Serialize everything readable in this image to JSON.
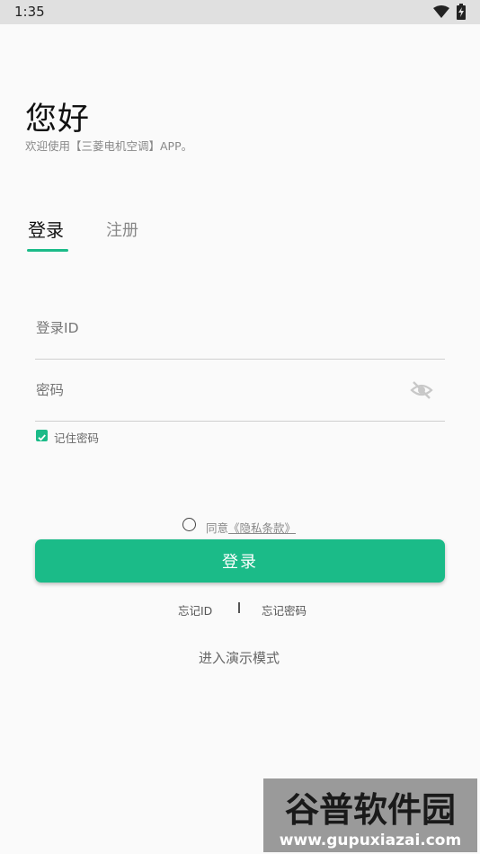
{
  "status_bar": {
    "time": "1:35"
  },
  "header": {
    "greeting": "您好",
    "welcome": "欢迎使用【三菱电机空调】APP。"
  },
  "tabs": [
    {
      "label": "登录",
      "active": true
    },
    {
      "label": "注册",
      "active": false
    }
  ],
  "form": {
    "login_id_placeholder": "登录ID",
    "password_placeholder": "密码",
    "remember_password": "记住密码",
    "remember_checked": true
  },
  "agreement": {
    "prefix": "同意",
    "link": "《隐私条款》",
    "checked": false
  },
  "login_button": "登录",
  "links": {
    "forgot_id": "忘记ID",
    "forgot_password": "忘记密码",
    "demo_mode": "进入演示模式"
  },
  "colors": {
    "accent": "#1bbb88",
    "background": "#fafafa",
    "status_bar": "#e0e0e0"
  },
  "watermark": {
    "brand": "谷普软件园",
    "url": "www.gupuxiazai.com"
  }
}
